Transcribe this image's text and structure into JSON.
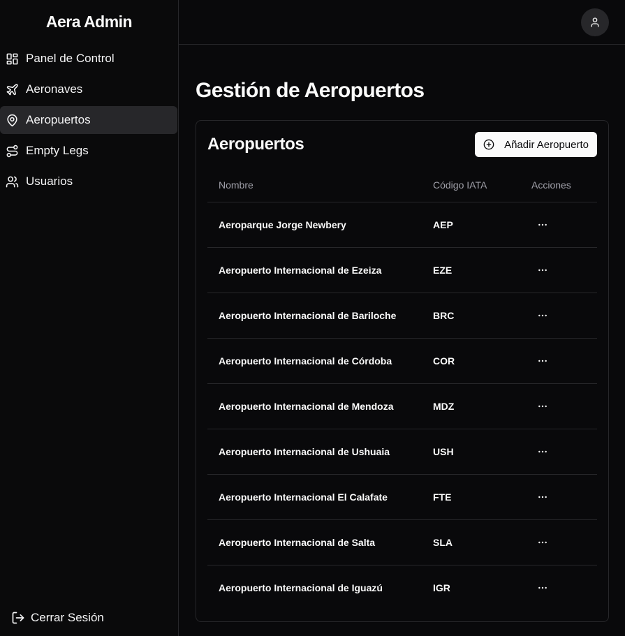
{
  "brand": "Aera Admin",
  "sidebar": {
    "items": [
      {
        "label": "Panel de Control",
        "icon": "layout-dashboard-icon"
      },
      {
        "label": "Aeronaves",
        "icon": "plane-icon"
      },
      {
        "label": "Aeropuertos",
        "icon": "map-pin-icon",
        "active": true
      },
      {
        "label": "Empty Legs",
        "icon": "route-icon"
      },
      {
        "label": "Usuarios",
        "icon": "users-icon"
      }
    ],
    "logout_label": "Cerrar Sesión"
  },
  "page": {
    "title": "Gestión de Aeropuertos"
  },
  "card": {
    "title": "Aeropuertos",
    "add_button_label": "Añadir Aeropuerto"
  },
  "table": {
    "headers": [
      "Nombre",
      "Código IATA",
      "Acciones"
    ],
    "rows": [
      {
        "name": "Aeroparque Jorge Newbery",
        "iata": "AEP"
      },
      {
        "name": "Aeropuerto Internacional de Ezeiza",
        "iata": "EZE"
      },
      {
        "name": "Aeropuerto Internacional de Bariloche",
        "iata": "BRC"
      },
      {
        "name": "Aeropuerto Internacional de Córdoba",
        "iata": "COR"
      },
      {
        "name": "Aeropuerto Internacional de Mendoza",
        "iata": "MDZ"
      },
      {
        "name": "Aeropuerto Internacional de Ushuaia",
        "iata": "USH"
      },
      {
        "name": "Aeropuerto Internacional El Calafate",
        "iata": "FTE"
      },
      {
        "name": "Aeropuerto Internacional de Salta",
        "iata": "SLA"
      },
      {
        "name": "Aeropuerto Internacional de Iguazú",
        "iata": "IGR"
      }
    ]
  },
  "colors": {
    "background": "#09090b",
    "border": "#27272a",
    "active_item": "#27272a",
    "text": "#fafafa",
    "muted": "#a1a1aa"
  }
}
